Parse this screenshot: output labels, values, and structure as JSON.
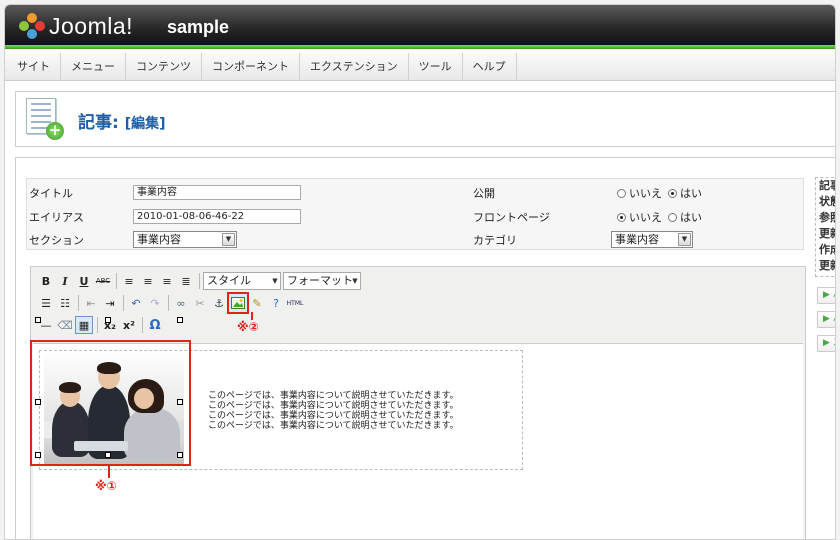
{
  "app": {
    "logo_text": "Joomla!",
    "site_name": "sample"
  },
  "menu": [
    "サイト",
    "メニュー",
    "コンテンツ",
    "コンポーネント",
    "エクステンション",
    "ツール",
    "ヘルプ"
  ],
  "page": {
    "title": "記事:",
    "subtitle": "[編集]"
  },
  "form": {
    "title_label": "タイトル",
    "title_value": "事業内容",
    "alias_label": "エイリアス",
    "alias_value": "2010-01-08-06-46-22",
    "section_label": "セクション",
    "section_value": "事業内容",
    "published_label": "公開",
    "frontpage_label": "フロントページ",
    "category_label": "カテゴリ",
    "category_value": "事業内容",
    "no_label": "いいえ",
    "yes_label": "はい"
  },
  "toolbar": {
    "bold": "B",
    "italic": "I",
    "underline": "U",
    "strike": "ABC",
    "style_dropdown": "スタイル",
    "format_dropdown": "フォーマット",
    "html_label": "HTML",
    "omega": "Ω",
    "sub": "x₂",
    "sup": "x²"
  },
  "editor": {
    "lines": [
      "このページでは、事業内容について説明させていただきます。",
      "このページでは、事業内容について説明させていただきます。",
      "このページでは、事業内容について説明させていただきます。",
      "このページでは、事業内容について説明させていただきます。"
    ]
  },
  "annotations": {
    "mark1": "※①",
    "mark2": "※②"
  },
  "sidebar": [
    "記事",
    "状態",
    "参照",
    "更新",
    "作成",
    "更新"
  ],
  "sidebar_buttons": [
    "▶ パ",
    "▶ パ",
    "▶ ス"
  ],
  "colors": {
    "accent": "#1d5ea5",
    "annotation": "#e2231a",
    "header_green": "#3c9b22"
  }
}
